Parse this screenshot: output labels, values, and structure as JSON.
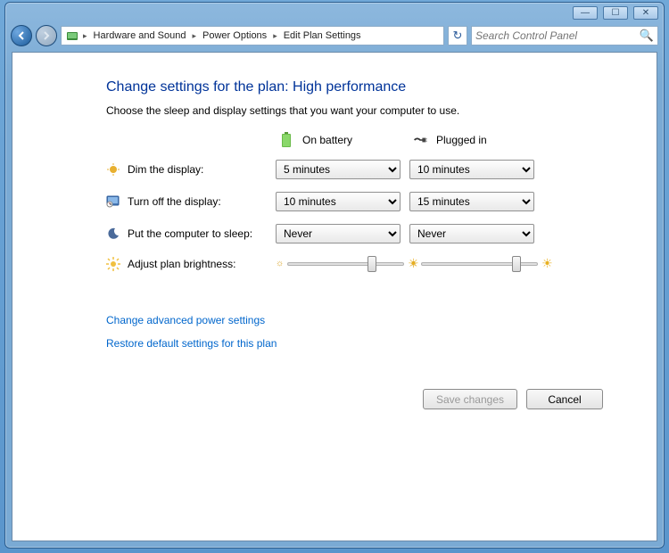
{
  "titlebar": {
    "minimize": "—",
    "maximize": "☐",
    "close": "✕"
  },
  "breadcrumb": {
    "items": [
      "Hardware and Sound",
      "Power Options",
      "Edit Plan Settings"
    ]
  },
  "search": {
    "placeholder": "Search Control Panel"
  },
  "page": {
    "title": "Change settings for the plan: High performance",
    "subtitle": "Choose the sleep and display settings that you want your computer to use."
  },
  "columns": {
    "battery": "On battery",
    "plugged": "Plugged in"
  },
  "rows": {
    "dim": {
      "label": "Dim the display:",
      "battery": "5 minutes",
      "plugged": "10 minutes"
    },
    "turnoff": {
      "label": "Turn off the display:",
      "battery": "10 minutes",
      "plugged": "15 minutes"
    },
    "sleep": {
      "label": "Put the computer to sleep:",
      "battery": "Never",
      "plugged": "Never"
    },
    "brightness": {
      "label": "Adjust plan brightness:"
    }
  },
  "links": {
    "advanced": "Change advanced power settings",
    "restore": "Restore default settings for this plan"
  },
  "buttons": {
    "save": "Save changes",
    "cancel": "Cancel"
  }
}
